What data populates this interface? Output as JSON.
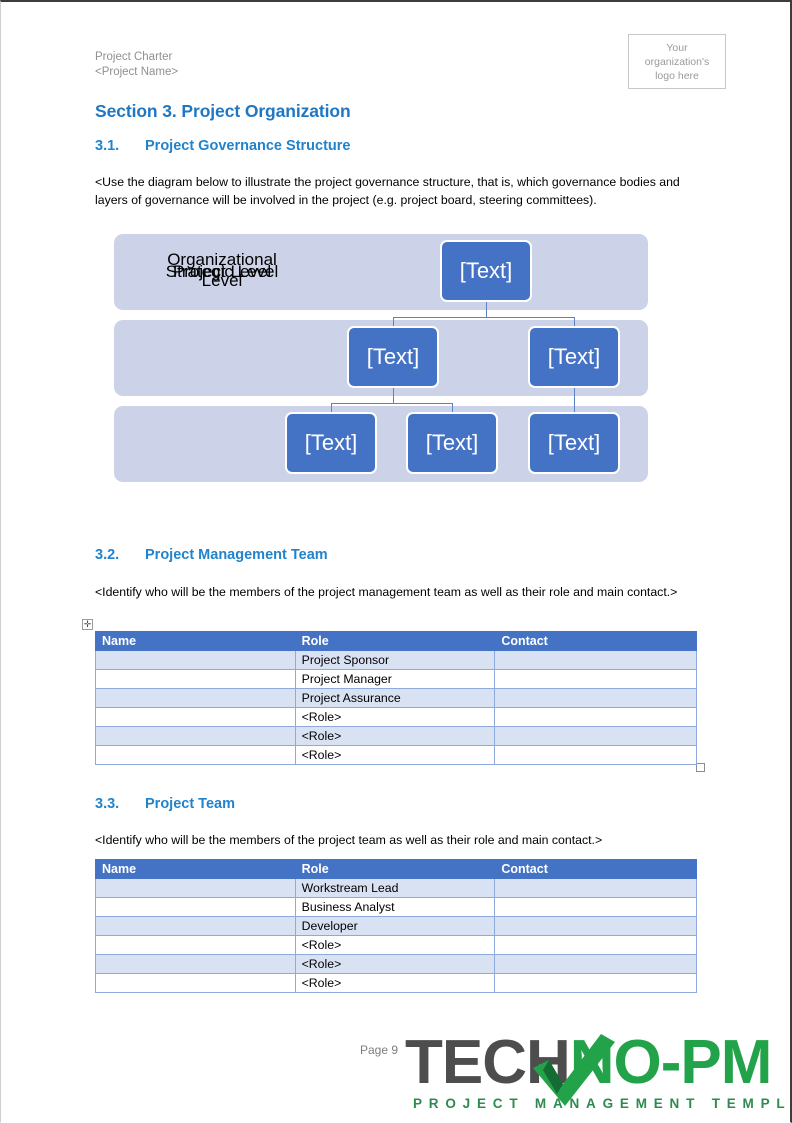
{
  "page": {
    "header": {
      "line1": "Project Charter",
      "line2": "<Project Name>"
    },
    "logo_placeholder": {
      "line1": "Your",
      "line2": "organization's",
      "line3": "logo here"
    },
    "section_title": "Section 3. Project Organization",
    "footer": {
      "page_label": "Page 9",
      "brand_dark": "TECH",
      "brand_green": "NO-PM",
      "brand_tagline": "PROJECT MANAGEMENT TEMPLATES"
    }
  },
  "subsections": {
    "s31": {
      "number": "3.1.",
      "title": "Project Governance Structure",
      "paragraph": "<Use the diagram below to illustrate the project governance structure, that is, which governance bodies and layers of governance will be involved in the project (e.g. project board, steering committees)."
    },
    "s32": {
      "number": "3.2.",
      "title": "Project Management Team",
      "paragraph": "<Identify who will be the members of the project management team as well as their role and main contact.>"
    },
    "s33": {
      "number": "3.3.",
      "title": "Project Team",
      "paragraph": "<Identify who will be the members of the project team as well as their role and main contact.>"
    }
  },
  "diagram": {
    "bands": [
      {
        "label": "Organizational\nLevel"
      },
      {
        "label": "Strategic Level"
      },
      {
        "label": "Project Level"
      }
    ],
    "nodes": {
      "organizational": [
        "[Text]"
      ],
      "strategic": [
        "[Text]",
        "[Text]"
      ],
      "project": [
        "[Text]",
        "[Text]",
        "[Text]"
      ]
    },
    "colors": {
      "band": "#ccd3e8",
      "node": "#4472c4",
      "connector": "#5b83c4",
      "node_text": "#ffffff"
    }
  },
  "tables": {
    "management_team": {
      "headers": [
        "Name",
        "Role",
        "Contact"
      ],
      "rows": [
        [
          "",
          "Project Sponsor",
          ""
        ],
        [
          "",
          "Project Manager",
          ""
        ],
        [
          "",
          "Project Assurance",
          ""
        ],
        [
          "",
          "<Role>",
          ""
        ],
        [
          "",
          "<Role>",
          ""
        ],
        [
          "",
          "<Role>",
          ""
        ]
      ]
    },
    "project_team": {
      "headers": [
        "Name",
        "Role",
        "Contact"
      ],
      "rows": [
        [
          "",
          "Workstream Lead",
          ""
        ],
        [
          "",
          "Business Analyst",
          ""
        ],
        [
          "",
          "Developer",
          ""
        ],
        [
          "",
          "<Role>",
          ""
        ],
        [
          "",
          "<Role>",
          ""
        ],
        [
          "",
          "<Role>",
          ""
        ]
      ]
    }
  },
  "colors": {
    "heading_blue": "#2283cc",
    "table_header_blue": "#4472c4",
    "table_border_blue": "#8ea9db",
    "table_stripe": "#d9e2f3",
    "brand_green": "#22a34a",
    "brand_dark": "#4d4d4d"
  },
  "handles": {
    "move_glyph": "✛",
    "resize_glyph": ""
  }
}
